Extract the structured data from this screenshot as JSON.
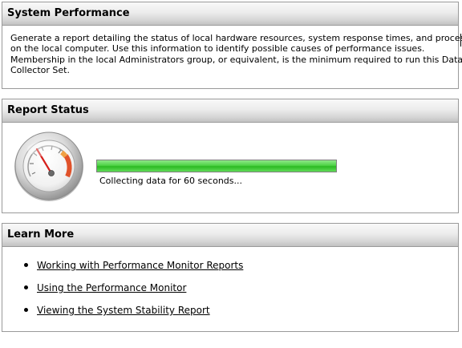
{
  "system_performance": {
    "title": "System Performance",
    "description_lines": [
      "Generate a report detailing the status of local hardware resources, system response times, and processes",
      "on the local computer. Use this information to identify possible causes of performance issues.",
      "Membership in the local Administrators group, or equivalent, is the minimum required to run this Data",
      "Collector Set."
    ]
  },
  "report_status": {
    "title": "Report Status",
    "gauge_icon": "performance-gauge-icon",
    "progress_fraction": 1.0,
    "status_text": "Collecting data for 60 seconds..."
  },
  "learn_more": {
    "title": "Learn More",
    "links": [
      {
        "label": "Working with Performance Monitor Reports"
      },
      {
        "label": "Using the Performance Monitor"
      },
      {
        "label": "Viewing the System Stability Report"
      }
    ]
  },
  "colors": {
    "progress_green": "#4ed346",
    "gauge_needle": "#d6201c",
    "gauge_redzone": "#e0522a"
  }
}
